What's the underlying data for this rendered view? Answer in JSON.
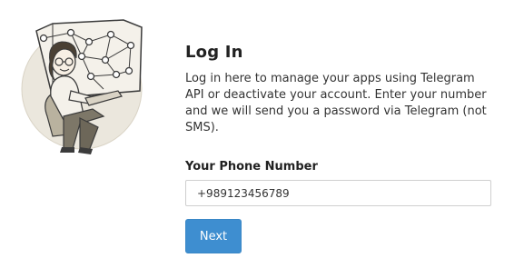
{
  "illustration": {
    "icon": "telegram-developer-illustration"
  },
  "login": {
    "title": "Log In",
    "description": "Log in here to manage your apps using Telegram API or deactivate your account. Enter your number and we will send you a password via Telegram (not SMS).",
    "phone_label": "Your Phone Number",
    "phone_value": "+989123456789",
    "next_label": "Next"
  },
  "colors": {
    "button_bg": "#3e8ed0",
    "text": "#222222"
  }
}
